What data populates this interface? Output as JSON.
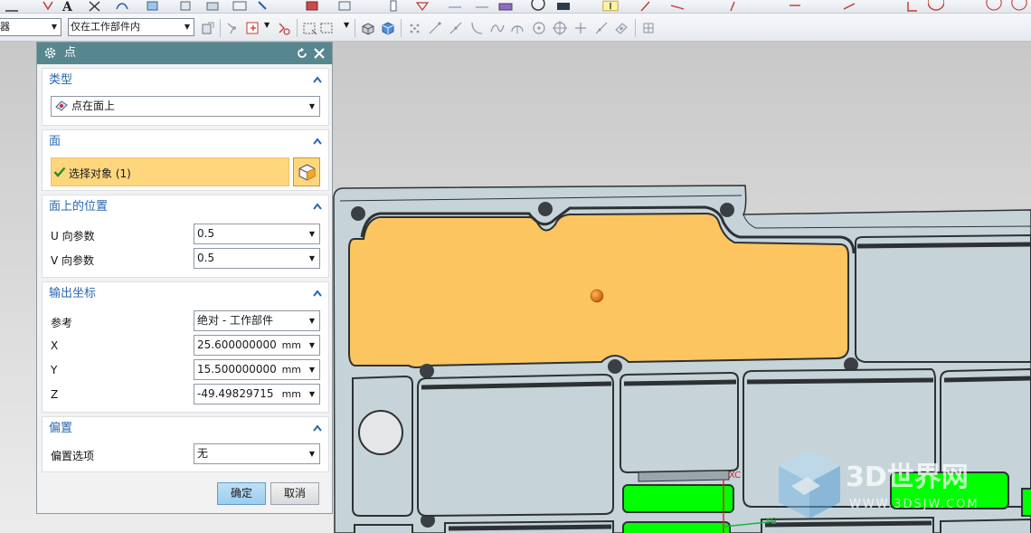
{
  "toolbar": {
    "filter_select": "器",
    "assembly_scope_select": "仅在工作部件内"
  },
  "dialog": {
    "title": "点",
    "sections": {
      "type": {
        "header": "类型",
        "value": "点在面上"
      },
      "face": {
        "header": "面",
        "selection_text": "选择对象 (1)"
      },
      "position": {
        "header": "面上的位置",
        "u_label": "U 向参数",
        "u_value": "0.5",
        "v_label": "V 向参数",
        "v_value": "0.5"
      },
      "output": {
        "header": "输出坐标",
        "ref_label": "参考",
        "ref_value": "绝对 - 工作部件",
        "x_label": "X",
        "x_value": "25.600000000",
        "y_label": "Y",
        "y_value": "15.500000000",
        "z_label": "Z",
        "z_value": "-49.49829715",
        "unit": "mm"
      },
      "offset": {
        "header": "偏置",
        "option_label": "偏置选项",
        "option_value": "无"
      }
    },
    "ok_label": "确定",
    "cancel_label": "取消"
  },
  "viewport": {
    "triad_x_label": "XC",
    "triad_y_label": "YC"
  },
  "watermark": {
    "brand": "3D世界网",
    "url": "WWW.3DSJW.COM"
  },
  "colors": {
    "selected_face": "#fcc55f",
    "highlight_row": "#fed67e",
    "title_bar": "#56878f",
    "green_face": "#00ff00",
    "part_face": "#c6d4da",
    "header_text": "#2867b0"
  },
  "icons": {
    "dialog_title": "gear-icon",
    "reset": "reset-icon",
    "close": "close-icon",
    "collapse": "chevron-up-icon",
    "type": "point-on-face-icon",
    "check": "checkmark-icon",
    "select_face": "cube-face-icon"
  }
}
